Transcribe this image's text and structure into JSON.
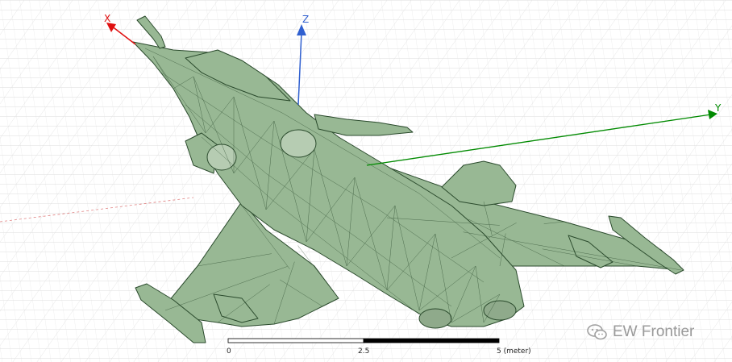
{
  "axes": {
    "x_label": "X",
    "y_label": "Y",
    "z_label": "Z",
    "x_color": "#e01010",
    "y_color": "#008a00",
    "z_color": "#3060d0"
  },
  "model": {
    "fill_color": "#98b894",
    "edge_color": "#2a4a2c"
  },
  "scale_bar": {
    "tick_0": "0",
    "tick_mid": "2.5",
    "tick_end": "5 (meter)"
  },
  "watermark": {
    "text": "EW Frontier",
    "icon": "wechat-icon"
  }
}
